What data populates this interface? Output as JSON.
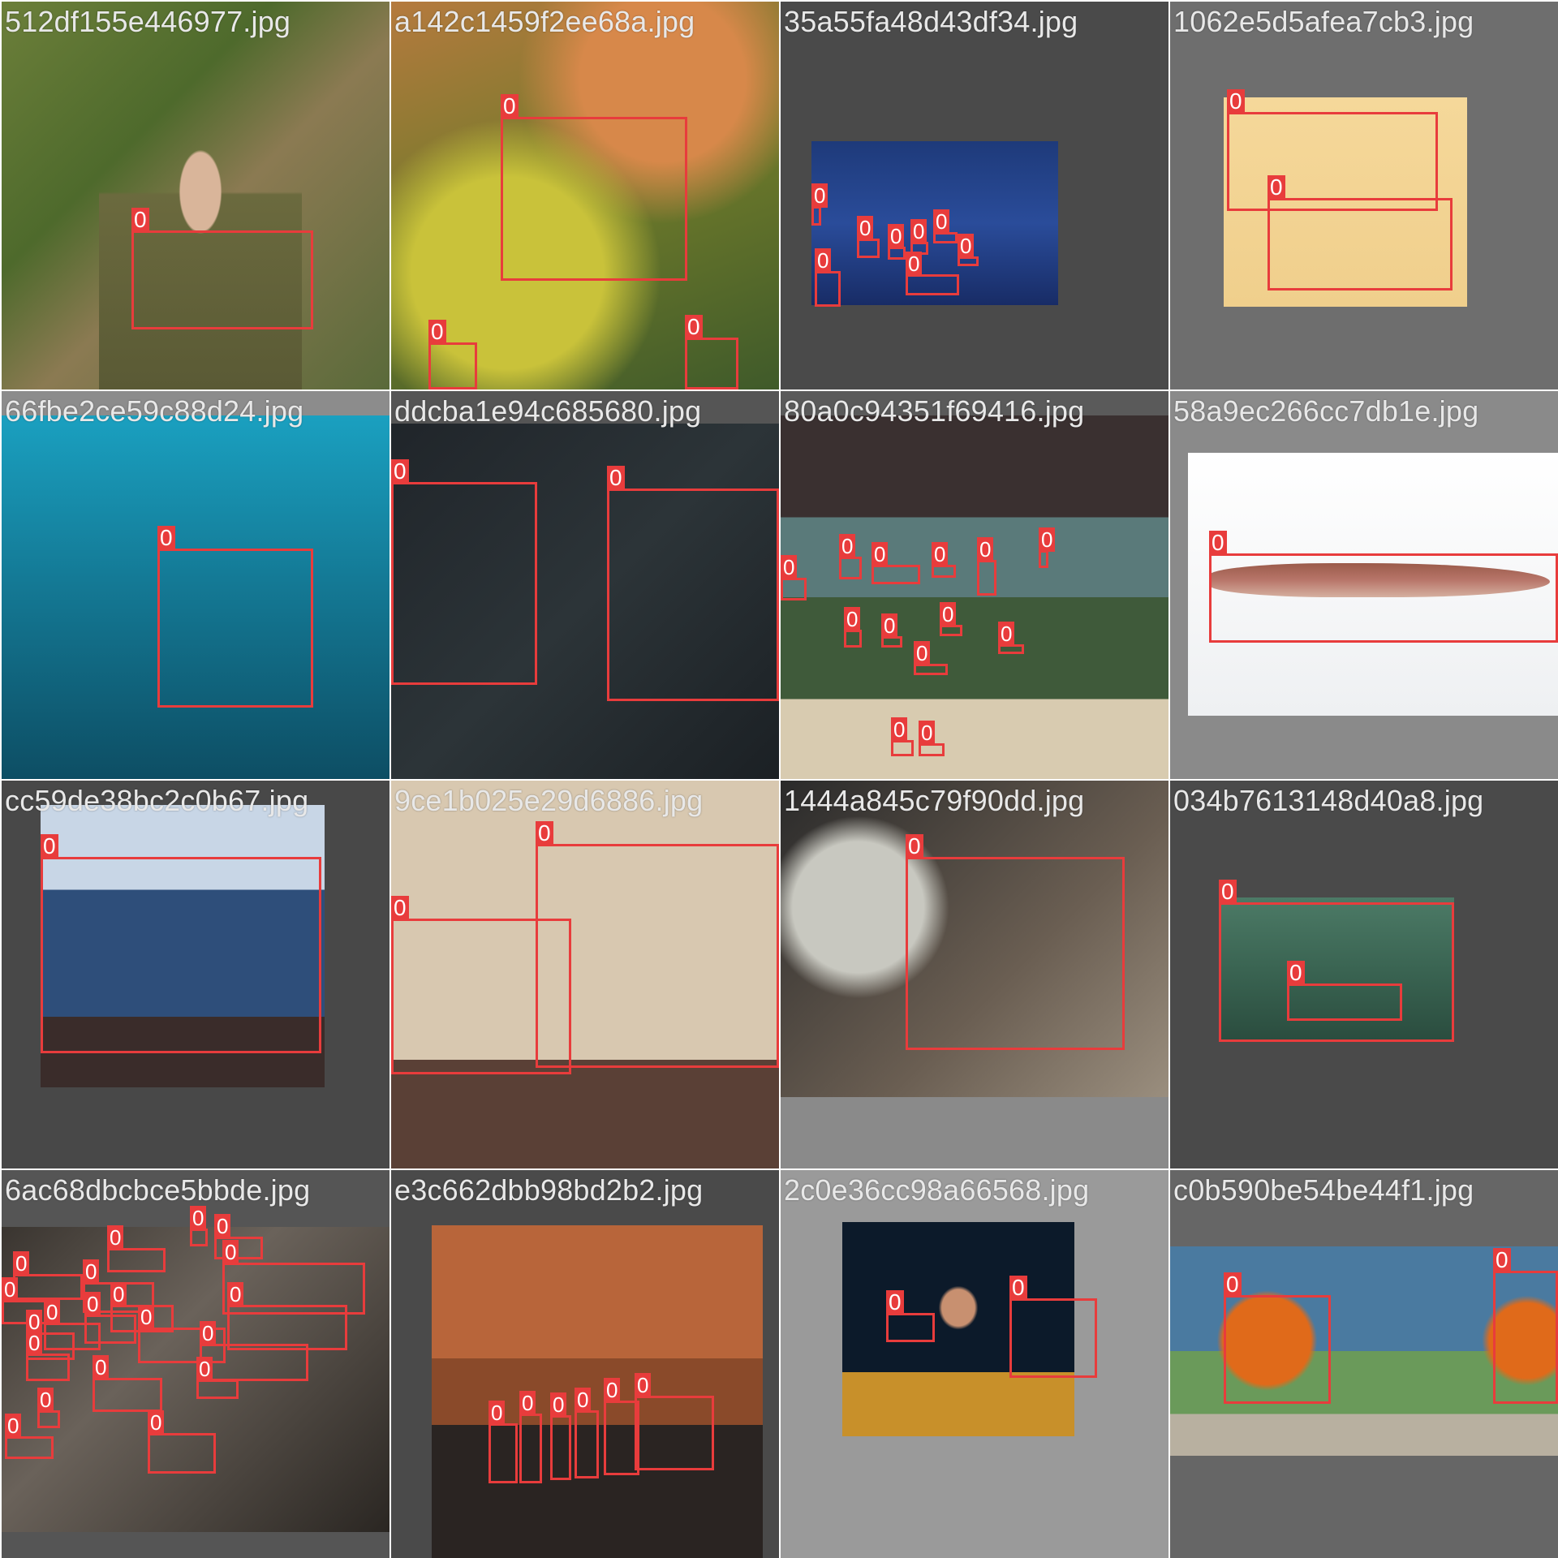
{
  "tiles": [
    {
      "filename": "512df155e446977.jpg",
      "label": "0",
      "bg": "#4a4a4a"
    },
    {
      "filename": "a142c1459f2ee68a.jpg",
      "label": "0",
      "bg": "#4a4a4a"
    },
    {
      "filename": "35a55fa48d43df34.jpg",
      "label": "0",
      "bg": "#4a4a4a"
    },
    {
      "filename": "1062e5d5afea7cb3.jpg",
      "label": "0",
      "bg": "#7a7a7a"
    },
    {
      "filename": "66fbe2ce59c88d24.jpg",
      "label": "0",
      "bg": "#8c8c8c"
    },
    {
      "filename": "ddcba1e94c685680.jpg",
      "label": "0",
      "bg": "#555555"
    },
    {
      "filename": "80a0c94351f69416.jpg",
      "label": "0",
      "bg": "#555555"
    },
    {
      "filename": "58a9ec266cc7db1e.jpg",
      "label": "0",
      "bg": "#8a8a8a"
    },
    {
      "filename": "cc59de38bc2c0b67.jpg",
      "label": "0",
      "bg": "#4a4a4a"
    },
    {
      "filename": "9ce1b025e29d6886.jpg",
      "label": "0",
      "bg": "#555555"
    },
    {
      "filename": "1444a845c79f90dd.jpg",
      "label": "0",
      "bg": "#8a8a8a"
    },
    {
      "filename": "034b7613148d40a8.jpg",
      "label": "0",
      "bg": "#4a4a4a"
    },
    {
      "filename": "6ac68dbcbce5bbde.jpg",
      "label": "0",
      "bg": "#555555"
    },
    {
      "filename": "e3c662dbb98bd2b2.jpg",
      "label": "0",
      "bg": "#4a4a4a"
    },
    {
      "filename": "2c0e36cc98a66568.jpg",
      "label": "0",
      "bg": "#9a9a9a"
    },
    {
      "filename": "c0b590be54be44f1.jpg",
      "label": "0",
      "bg": "#666666"
    }
  ],
  "colors": {
    "box": "#e83c3c",
    "label_text": "#ffffff",
    "filename_text": "#e8e8e8"
  }
}
